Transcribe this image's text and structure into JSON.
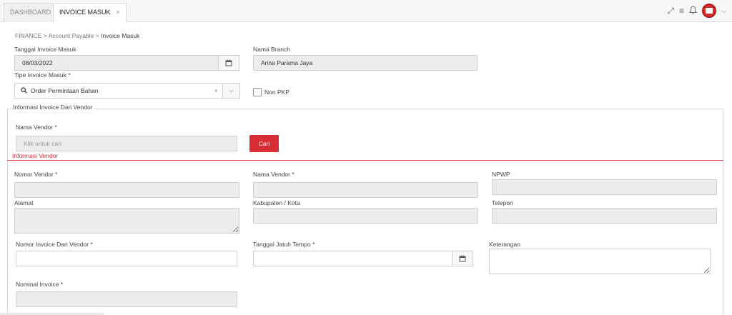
{
  "tabs": [
    {
      "label": "DASHBOARD"
    },
    {
      "label": "INVOICE MASUK",
      "close": "×"
    }
  ],
  "breadcrumb": {
    "items": [
      "FINANCE",
      "Account Payable",
      "Invoice Masuk"
    ],
    "sep": ">"
  },
  "form": {
    "tanggal_invoice": {
      "label": "Tanggal Invoice Masuk",
      "value": "08/03/2022"
    },
    "nama_branch": {
      "label": "Nama Branch",
      "value": "Arina Parama Jaya"
    },
    "tipe_invoice": {
      "label": "Tipe Invoice Masuk *",
      "value": "Order Permintaan Bahan",
      "clear": "×"
    },
    "non_pkp": {
      "label": "Non PKP"
    }
  },
  "vendor_section": {
    "legend": "Informasi Invoice Dari Vendor",
    "nama_vendor_label": "Nama Vendor *",
    "search_placeholder": "Klik untuk cari",
    "cari_label": "Cari",
    "info_title": "Informasi Vendor"
  },
  "fields": {
    "nomor_vendor": "Nomor Vendor *",
    "nama_vendor": "Nama Vendor *",
    "npwp": "NPWP",
    "alamat": "Alamat",
    "kabupaten": "Kabupaten / Kota",
    "telepon": "Telepon",
    "nomor_invoice": "Nomor Invoice Dari Vendor *",
    "tanggal_jatuh_tempo": "Tanggal Jatuh Tempo *",
    "keterangan": "Keterangan",
    "nominal_invoice": "Nominal Invoice *"
  },
  "icons": {
    "expand": "expand-icon",
    "menu": "menu-icon",
    "bell": "bell-icon",
    "calendar": "calendar-icon",
    "search": "search-icon",
    "chevron": "chevron-down-icon"
  }
}
